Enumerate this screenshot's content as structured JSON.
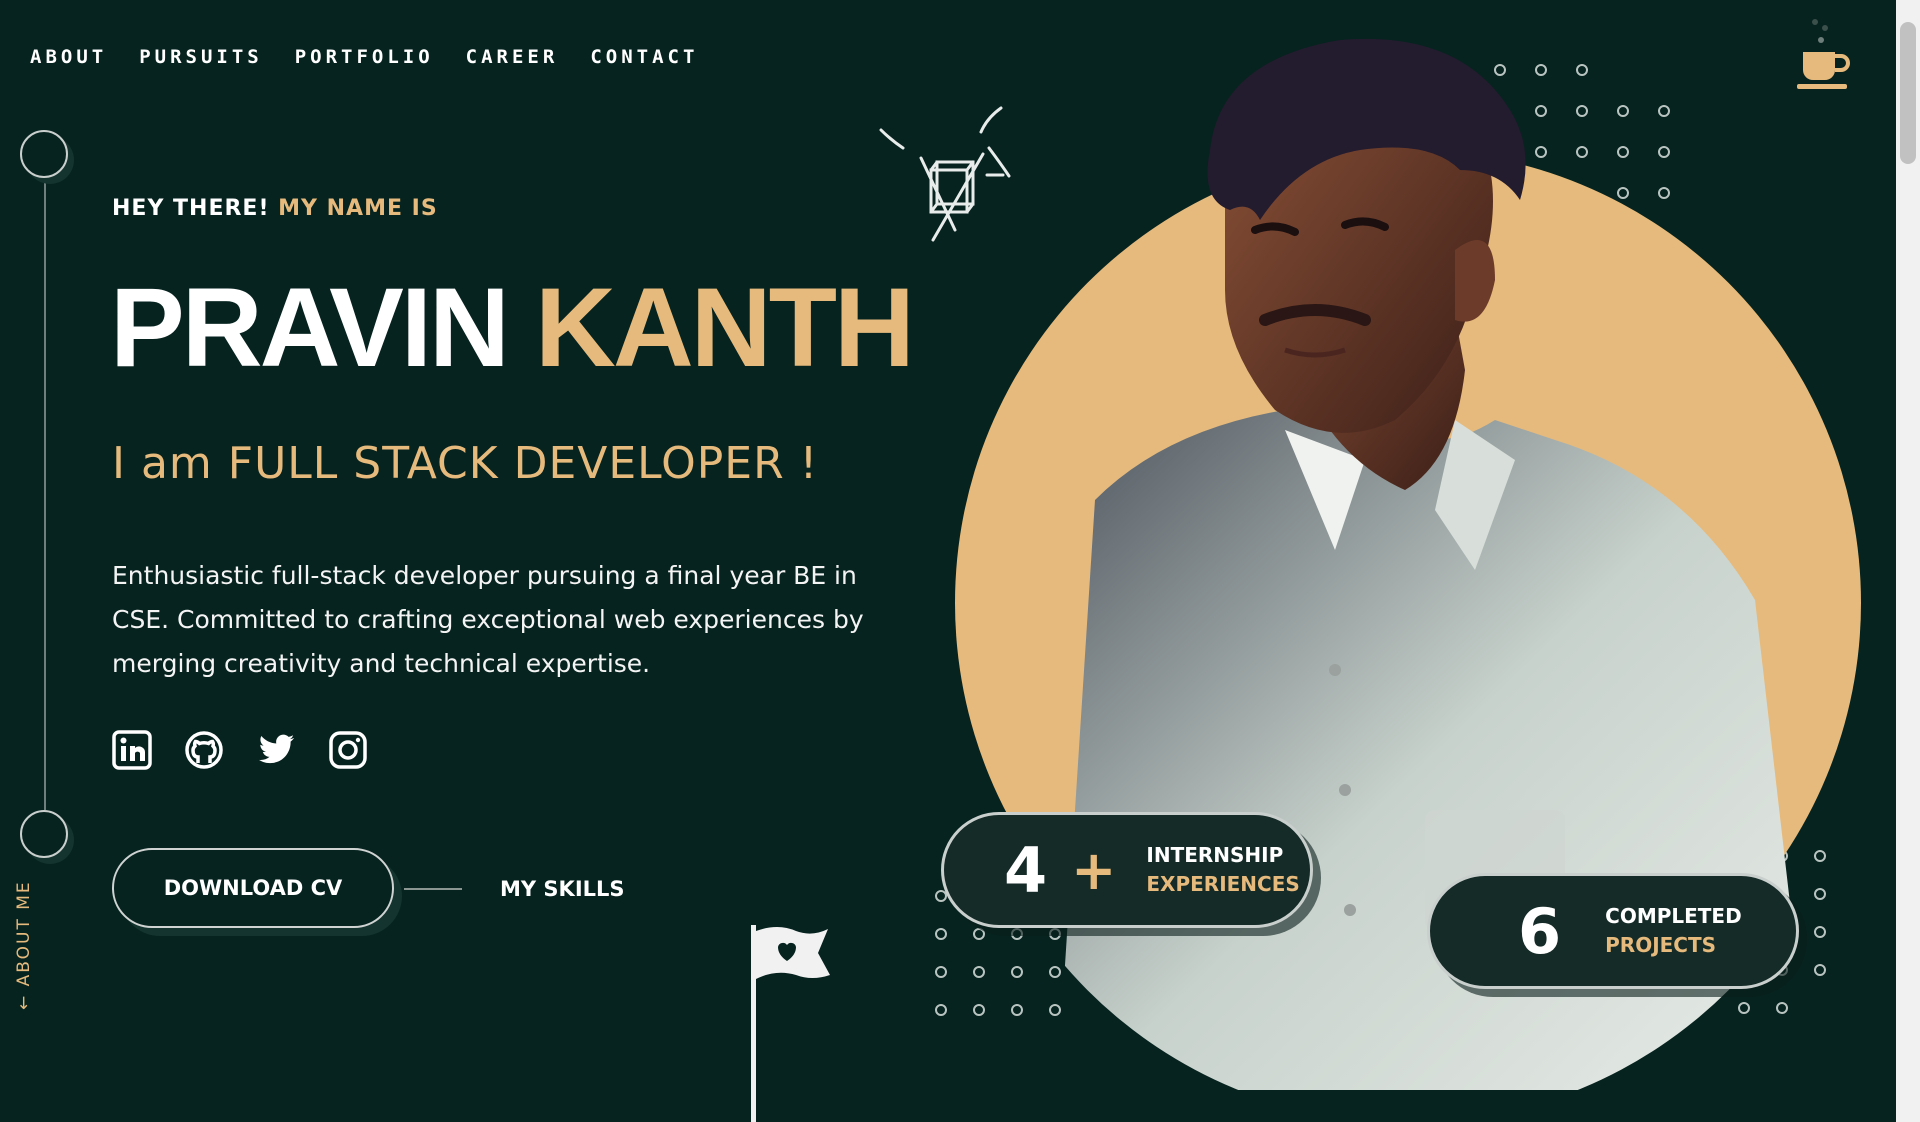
{
  "nav": {
    "items": [
      {
        "label": "ABOUT"
      },
      {
        "label": "PURSUITS"
      },
      {
        "label": "PORTFOLIO"
      },
      {
        "label": "CAREER"
      },
      {
        "label": "CONTACT"
      }
    ]
  },
  "header": {
    "icon": "coffee-cup-icon"
  },
  "hero": {
    "greeting_prefix": "HEY THERE!",
    "greeting_suffix": "MY NAME IS",
    "first_name": "PRAVIN",
    "last_name": "KANTH",
    "role": "I am  FULL STACK DEVELOPER !",
    "description": "Enthusiastic full-stack developer pursuing a final year BE in CSE. Committed to crafting exceptional web experiences by merging creativity and technical expertise.",
    "socials": [
      {
        "icon": "linkedin-icon"
      },
      {
        "icon": "github-icon"
      },
      {
        "icon": "twitter-icon"
      },
      {
        "icon": "instagram-icon"
      }
    ],
    "download_cv": "DOWNLOAD CV",
    "my_skills": "MY SKILLS",
    "side_label": "← ABOUT ME"
  },
  "stats": [
    {
      "number": "4",
      "suffix": "+",
      "label_line1": "INTERNSHIP",
      "label_line2": "EXPERIENCES"
    },
    {
      "number": "6",
      "suffix": "",
      "label_line1": "COMPLETED",
      "label_line2": "PROJECTS"
    }
  ],
  "colors": {
    "background": "#06231f",
    "accent": "#e6ba7c",
    "text": "#ffffff"
  }
}
